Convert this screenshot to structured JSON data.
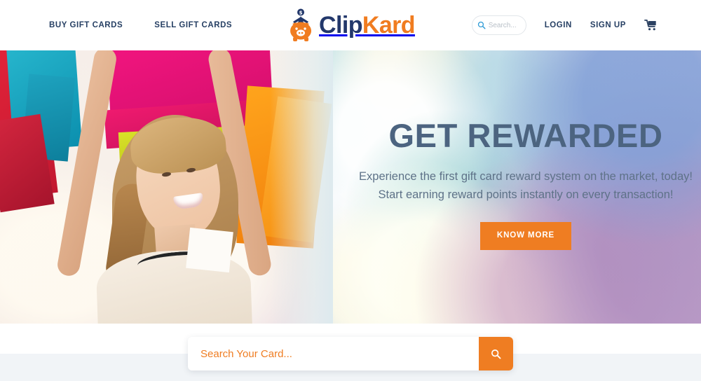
{
  "header": {
    "nav_links": [
      {
        "label": "BUY GIFT CARDS",
        "name": "nav-buy-gift-cards"
      },
      {
        "label": "SELL GIFT CARDS",
        "name": "nav-sell-gift-cards"
      }
    ],
    "logo": {
      "part1": "Clip",
      "part2": "Kard",
      "mark": "piggy-bank-icon",
      "color_part1": "#23386b",
      "color_part2": "#f07c20"
    },
    "search": {
      "placeholder": "Search...",
      "value": "",
      "icon": "search-icon"
    },
    "login_label": "LOGIN",
    "signup_label": "SIGN UP",
    "cart_icon": "shopping-cart-icon"
  },
  "hero": {
    "title": "GET REWARDED",
    "subtitle_line1": "Experience the first gift card reward system on the market, today!",
    "subtitle_line2": "Start earning reward points instantly on every transaction!",
    "cta_label": "KNOW MORE",
    "cta_color": "#ef7d22",
    "title_color": "#4c6480",
    "subtitle_color": "#5e7288"
  },
  "card_search": {
    "placeholder": "Search Your Card...",
    "value": "",
    "button_icon": "search-icon",
    "button_color": "#ef7d22",
    "text_color": "#ef7d22"
  },
  "bands": {
    "white_band_color": "#ffffff",
    "gray_band_color": "#f1f4f7"
  }
}
